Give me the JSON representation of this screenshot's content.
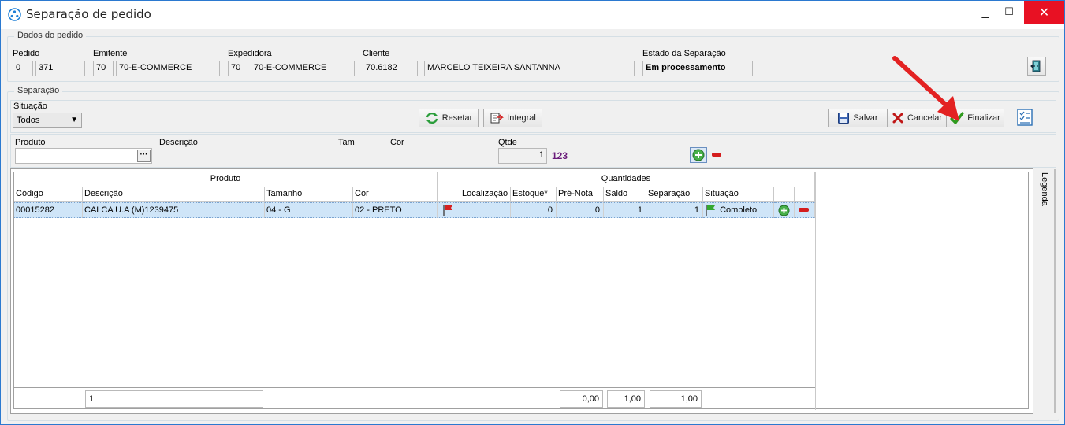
{
  "window": {
    "title": "Separação de pedido",
    "minimize": "▁",
    "maximize": "☐",
    "close": "✕"
  },
  "dados": {
    "group_title": "Dados do pedido",
    "pedido_label": "Pedido",
    "pedido_a": "0",
    "pedido_b": "371",
    "emitente_label": "Emitente",
    "emitente_code": "70",
    "emitente_name": "70-E-COMMERCE",
    "expedidora_label": "Expedidora",
    "expedidora_code": "70",
    "expedidora_name": "70-E-COMMERCE",
    "cliente_label": "Cliente",
    "cliente_code": "70.6182",
    "cliente_name": "MARCELO TEIXEIRA SANTANNA",
    "estado_label": "Estado da Separação",
    "estado_value": "Em processamento"
  },
  "separacao": {
    "group_title": "Separação",
    "situacao_label": "Situação",
    "situacao_value": "Todos",
    "resetar": "Resetar",
    "integral": "Integral",
    "salvar": "Salvar",
    "cancelar": "Cancelar",
    "finalizar": "Finalizar"
  },
  "entry": {
    "produto_label": "Produto",
    "produto_value": "",
    "browse": "···",
    "descricao_label": "Descrição",
    "tam_label": "Tam",
    "cor_label": "Cor",
    "qtde_label": "Qtde",
    "qtde_value": "1",
    "qtde_extra": "123"
  },
  "grid": {
    "group_produto": "Produto",
    "group_quantidades": "Quantidades",
    "columns": [
      "Código",
      "Descrição",
      "Tamanho",
      "Cor",
      "",
      "Localização",
      "Estoque*",
      "Pré-Nota",
      "Saldo",
      "Separação",
      "Situação",
      "",
      ""
    ],
    "rows": [
      {
        "codigo": "00015282",
        "descricao": "CALCA U.A (M)1239475",
        "tamanho": "04 - G",
        "cor": "02 - PRETO",
        "localizacao": "",
        "estoque": "0",
        "pre_nota": "0",
        "saldo": "1",
        "separacao": "1",
        "situacao": "Completo"
      }
    ],
    "footer": {
      "count": "1",
      "pre_nota": "0,00",
      "saldo": "1,00",
      "separacao": "1,00"
    },
    "legenda": "Legenda"
  },
  "colors": {
    "accent_purple": "#6a1b7a",
    "selection": "#cfe5f8",
    "close_red": "#e81123"
  }
}
